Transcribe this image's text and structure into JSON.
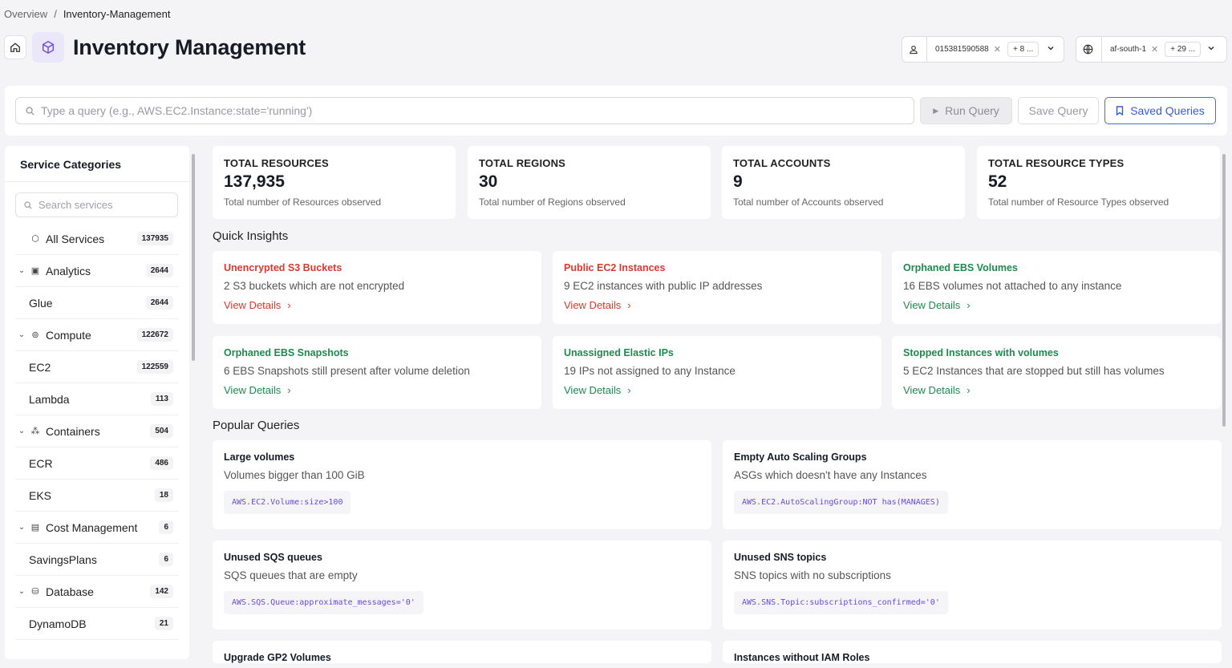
{
  "breadcrumb": {
    "root": "Overview",
    "separator": "/",
    "current": "Inventory-Management"
  },
  "header": {
    "title": "Inventory Management"
  },
  "filters": {
    "account": {
      "value": "015381590588",
      "more": "+ 8 ..."
    },
    "region": {
      "value": "af-south-1",
      "more": "+ 29 ..."
    }
  },
  "query": {
    "placeholder": "Type a query (e.g., AWS.EC2.Instance:state='running')",
    "run_label": "Run Query",
    "save_label": "Save Query",
    "saved_label": "Saved Queries"
  },
  "sidebar": {
    "title": "Service Categories",
    "search_placeholder": "Search services",
    "items": [
      {
        "label": "All Services",
        "count": "137935"
      },
      {
        "label": "Analytics",
        "count": "2644"
      },
      {
        "label": "Glue",
        "count": "2644"
      },
      {
        "label": "Compute",
        "count": "122672"
      },
      {
        "label": "EC2",
        "count": "122559"
      },
      {
        "label": "Lambda",
        "count": "113"
      },
      {
        "label": "Containers",
        "count": "504"
      },
      {
        "label": "ECR",
        "count": "486"
      },
      {
        "label": "EKS",
        "count": "18"
      },
      {
        "label": "Cost Management",
        "count": "6"
      },
      {
        "label": "SavingsPlans",
        "count": "6"
      },
      {
        "label": "Database",
        "count": "142"
      },
      {
        "label": "DynamoDB",
        "count": "21"
      }
    ]
  },
  "stats": [
    {
      "label": "TOTAL RESOURCES",
      "value": "137,935",
      "desc": "Total number of Resources observed"
    },
    {
      "label": "TOTAL REGIONS",
      "value": "30",
      "desc": "Total number of Regions observed"
    },
    {
      "label": "TOTAL ACCOUNTS",
      "value": "9",
      "desc": "Total number of Accounts observed"
    },
    {
      "label": "TOTAL RESOURCE TYPES",
      "value": "52",
      "desc": "Total number of Resource Types observed"
    }
  ],
  "quick_insights": {
    "heading": "Quick Insights",
    "view_details": "View Details",
    "items": [
      {
        "title": "Unencrypted S3 Buckets",
        "desc": "2 S3 buckets which are not encrypted"
      },
      {
        "title": "Public EC2 Instances",
        "desc": "9 EC2 instances with public IP addresses"
      },
      {
        "title": "Orphaned EBS Volumes",
        "desc": "16 EBS volumes not attached to any instance"
      },
      {
        "title": "Orphaned EBS Snapshots",
        "desc": "6 EBS Snapshots still present after volume deletion"
      },
      {
        "title": "Unassigned Elastic IPs",
        "desc": "19 IPs not assigned to any Instance"
      },
      {
        "title": "Stopped Instances with volumes",
        "desc": "5 EC2 Instances that are stopped but still has volumes"
      }
    ],
    "colors": {
      "danger": "#d93a2f",
      "ok": "#1e8a4f"
    }
  },
  "popular_queries": {
    "heading": "Popular Queries",
    "items": [
      {
        "title": "Large volumes",
        "desc": "Volumes bigger than 100 GiB",
        "code": "AWS.EC2.Volume:size>100"
      },
      {
        "title": "Empty Auto Scaling Groups",
        "desc": "ASGs which doesn't have any Instances",
        "code": "AWS.EC2.AutoScalingGroup:NOT has(MANAGES)"
      },
      {
        "title": "Unused SQS queues",
        "desc": "SQS queues that are empty",
        "code": "AWS.SQS.Queue:approximate_messages='0'"
      },
      {
        "title": "Unused SNS topics",
        "desc": "SNS topics with no subscriptions",
        "code": "AWS.SNS.Topic:subscriptions_confirmed='0'"
      },
      {
        "title": "Upgrade GP2 Volumes",
        "desc": "",
        "code": ""
      },
      {
        "title": "Instances without IAM Roles",
        "desc": "",
        "code": ""
      }
    ]
  },
  "accent": "#3a5bd9"
}
